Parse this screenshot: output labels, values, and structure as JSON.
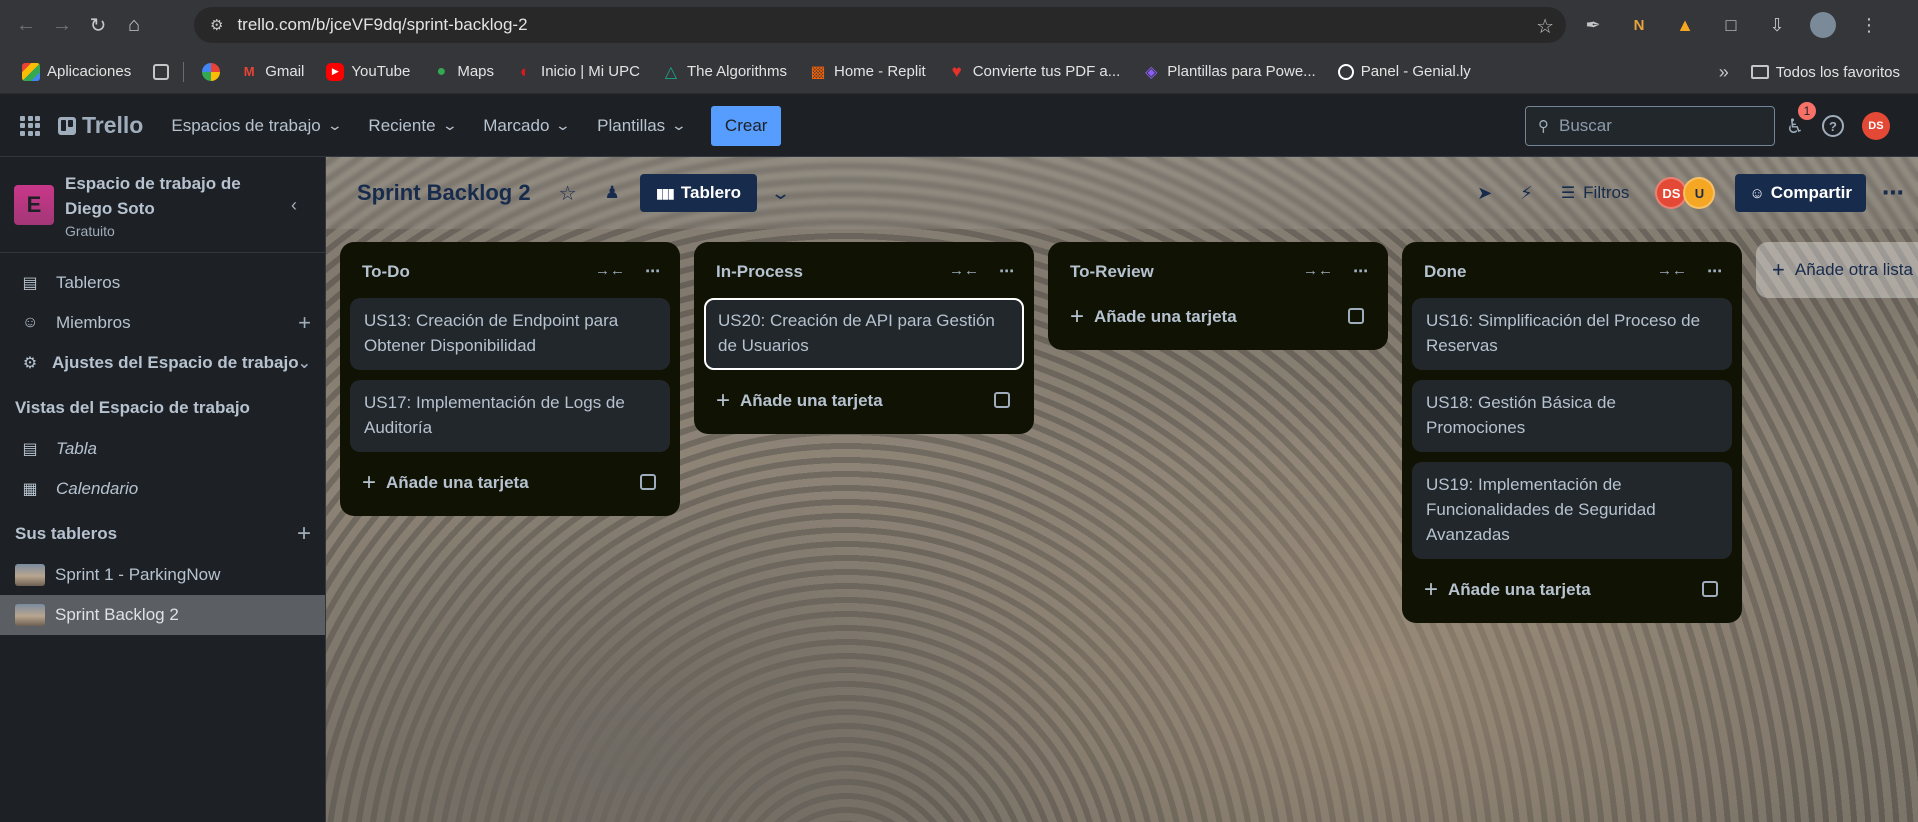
{
  "browser": {
    "url": "trello.com/b/jceVF9dq/sprint-backlog-2",
    "bookmarks": [
      {
        "label": "Aplicaciones",
        "icon": "apps-icon",
        "color": "#ea4335"
      },
      {
        "label": "Gmail",
        "icon": "gmail-icon",
        "color": "#ea4335"
      },
      {
        "label": "YouTube",
        "icon": "youtube-icon",
        "color": "#ff0000"
      },
      {
        "label": "Maps",
        "icon": "maps-icon",
        "color": "#34a853"
      },
      {
        "label": "Inicio | Mi UPC",
        "icon": "upc-icon",
        "color": "#d71920"
      },
      {
        "label": "The Algorithms",
        "icon": "algorithms-icon",
        "color": "#1aa38a"
      },
      {
        "label": "Home - Replit",
        "icon": "replit-icon",
        "color": "#f26207"
      },
      {
        "label": "Convierte tus PDF a...",
        "icon": "pdf-heart-icon",
        "color": "#e5322d"
      },
      {
        "label": "Plantillas para Powe...",
        "icon": "slides-icon",
        "color": "#8b5cf6"
      },
      {
        "label": "Panel - Genial.ly",
        "icon": "genially-icon",
        "color": "#ffffff"
      }
    ],
    "all_bookmarks": "Todos los favoritos"
  },
  "trello": {
    "logo": "Trello",
    "menu": [
      "Espacios de trabajo",
      "Reciente",
      "Marcado",
      "Plantillas"
    ],
    "create": "Crear",
    "search_placeholder": "Buscar",
    "notification_count": "1",
    "user_initials": "DS"
  },
  "sidebar": {
    "workspace_initial": "E",
    "workspace_name": "Espacio de trabajo de Diego Soto",
    "workspace_plan": "Gratuito",
    "items": [
      {
        "label": "Tableros",
        "icon": "board-icon"
      },
      {
        "label": "Miembros",
        "icon": "person-icon"
      },
      {
        "label": "Ajustes del Espacio de trabajo",
        "icon": "gear-icon"
      }
    ],
    "views_title": "Vistas del Espacio de trabajo",
    "views": [
      {
        "label": "Tabla",
        "icon": "table-icon"
      },
      {
        "label": "Calendario",
        "icon": "calendar-icon"
      }
    ],
    "boards_title": "Sus tableros",
    "boards": [
      "Sprint 1 - ParkingNow",
      "Sprint Backlog 2"
    ]
  },
  "board": {
    "title": "Sprint Backlog 2",
    "view": "Tablero",
    "filters": "Filtros",
    "members": [
      "DS",
      "U"
    ],
    "share": "Compartir",
    "add_card": "Añade una tarjeta",
    "add_list": "Añade otra lista",
    "lists": [
      {
        "title": "To-Do",
        "cards": [
          "US13: Creación de Endpoint para Obtener Disponibilidad",
          "US17: Implementación de Logs de Auditoría"
        ]
      },
      {
        "title": "In-Process",
        "cards": [
          "US20: Creación de API para Gestión de Usuarios"
        ]
      },
      {
        "title": "To-Review",
        "cards": []
      },
      {
        "title": "Done",
        "cards": [
          "US16: Simplificación del Proceso de Reservas",
          "US18: Gestión Básica de Promociones",
          "US19: Implementación de Funcionalidades de Seguridad Avanzadas"
        ]
      }
    ]
  }
}
